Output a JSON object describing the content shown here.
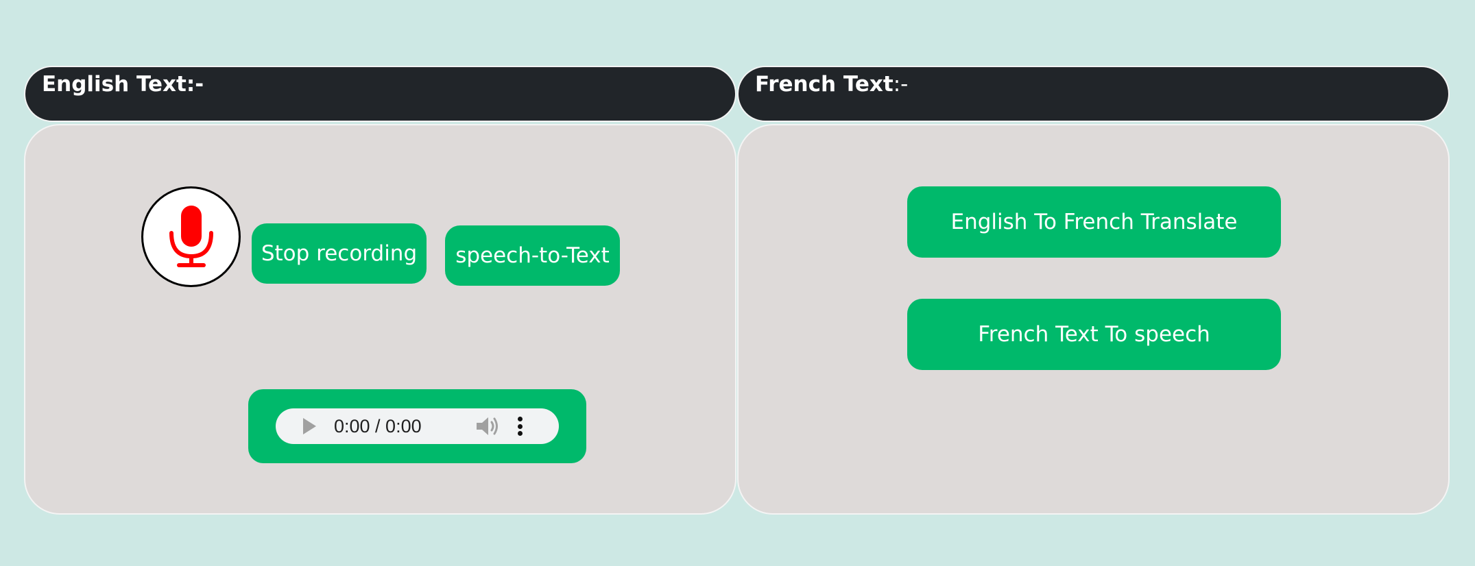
{
  "left_panel": {
    "header_title": "English Text",
    "header_suffix": ":-",
    "mic_icon": "microphone-icon",
    "stop_recording_label": "Stop recording",
    "speech_to_text_label": "speech-to-Text",
    "audio_player": {
      "time": "0:00 / 0:00",
      "play_icon": "play-icon",
      "volume_icon": "volume-icon",
      "menu_icon": "more-vertical-icon"
    }
  },
  "right_panel": {
    "header_title": "French Text",
    "header_suffix": ":-",
    "translate_label": "English To French Translate",
    "french_tts_label": "French Text To speech"
  },
  "colors": {
    "background": "#cde8e4",
    "header": "#212529",
    "panel": "#dedad9",
    "accent": "#00b96b",
    "mic": "#ff0000"
  }
}
